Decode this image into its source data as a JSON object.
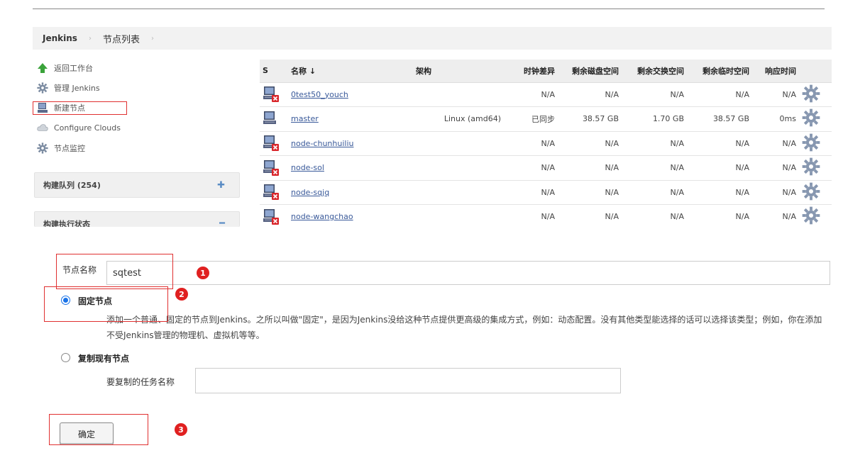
{
  "breadcrumb": {
    "root": "Jenkins",
    "current": "节点列表"
  },
  "sidebar": {
    "items": [
      {
        "label": "返回工作台",
        "icon": "up-arrow-icon"
      },
      {
        "label": "管理 Jenkins",
        "icon": "gear-icon"
      },
      {
        "label": "新建节点",
        "icon": "computer-icon"
      },
      {
        "label": "Configure Clouds",
        "icon": "cloud-icon"
      },
      {
        "label": "节点监控",
        "icon": "gear-icon"
      }
    ],
    "build_queue": {
      "label": "构建队列 (254)",
      "toggle": "✚"
    },
    "executor_status": {
      "label": "构建执行状态",
      "toggle": "━"
    }
  },
  "table": {
    "headers": {
      "s": "S",
      "name": "名称 ↓",
      "arch": "架构",
      "clock": "时钟差异",
      "disk": "剩余磁盘空间",
      "swap": "剩余交换空间",
      "temp": "剩余临时空间",
      "resp": "响应时间"
    },
    "rows": [
      {
        "name": "0test50_youch",
        "arch": "",
        "clock": "N/A",
        "disk": "N/A",
        "swap": "N/A",
        "temp": "N/A",
        "resp": "N/A",
        "offline": true
      },
      {
        "name": "master",
        "arch": "Linux (amd64)",
        "clock": "已同步",
        "disk": "38.57 GB",
        "swap": "1.70 GB",
        "temp": "38.57 GB",
        "resp": "0ms",
        "offline": false
      },
      {
        "name": "node-chunhuiliu",
        "arch": "",
        "clock": "N/A",
        "disk": "N/A",
        "swap": "N/A",
        "temp": "N/A",
        "resp": "N/A",
        "offline": true
      },
      {
        "name": "node-sol",
        "arch": "",
        "clock": "N/A",
        "disk": "N/A",
        "swap": "N/A",
        "temp": "N/A",
        "resp": "N/A",
        "offline": true
      },
      {
        "name": "node-sqjq",
        "arch": "",
        "clock": "N/A",
        "disk": "N/A",
        "swap": "N/A",
        "temp": "N/A",
        "resp": "N/A",
        "offline": true
      },
      {
        "name": "node-wangchao",
        "arch": "",
        "clock": "N/A",
        "disk": "N/A",
        "swap": "N/A",
        "temp": "N/A",
        "resp": "N/A",
        "offline": true
      }
    ]
  },
  "form": {
    "node_name_label": "节点名称",
    "node_name_value": "sqtest",
    "permanent": {
      "label": "固定节点",
      "selected": true,
      "description": "添加一个普通、固定的节点到Jenkins。之所以叫做\"固定\"，是因为Jenkins没给这种节点提供更高级的集成方式，例如：动态配置。没有其他类型能选择的话可以选择该类型；例如，你在添加不受Jenkins管理的物理机、虚拟机等等。"
    },
    "copy": {
      "label": "复制现有节点",
      "selected": false,
      "field_label": "要复制的任务名称",
      "field_value": ""
    },
    "ok_label": "确定"
  },
  "annotations": {
    "step1": "1",
    "step2": "2",
    "step3": "3",
    "color": "#e02020"
  }
}
